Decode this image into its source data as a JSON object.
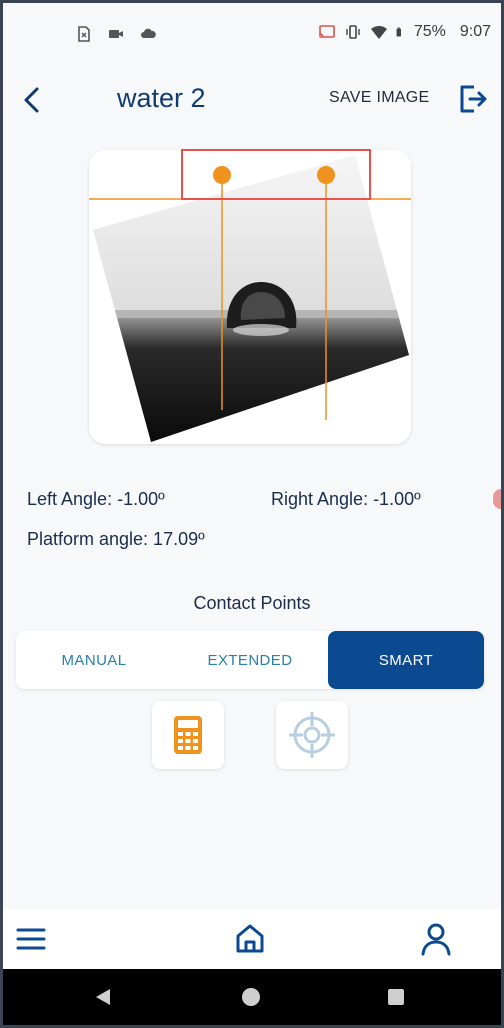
{
  "status_bar": {
    "battery": "75%",
    "time": "9:07",
    "left_icons": [
      "no-sim-icon",
      "video-icon",
      "cloud-icon"
    ],
    "right_icons": [
      "cast-icon",
      "vibrate-icon",
      "wifi-icon",
      "battery-icon"
    ]
  },
  "header": {
    "title": "water 2",
    "save_label": "SAVE IMAGE",
    "back_icon": "chevron-left-icon",
    "exit_icon": "logout-icon"
  },
  "measurements": {
    "left_angle": "Left Angle: -1.00º",
    "right_angle": "Right Angle: -1.00º",
    "platform_angle": "Platform angle: 17.09º"
  },
  "contact_points": {
    "title": "Contact Points",
    "modes": [
      "MANUAL",
      "EXTENDED",
      "SMART"
    ],
    "selected": "SMART"
  },
  "tools": [
    "calculator-icon",
    "crosshair-icon"
  ],
  "bottom_nav": [
    "menu-icon",
    "home-icon",
    "profile-icon"
  ],
  "system_nav": [
    "back-triangle-icon",
    "home-circle-icon",
    "recents-square-icon"
  ],
  "colors": {
    "primary": "#0b4a91",
    "title": "#0d3c73",
    "accent_orange": "#f0921e",
    "highlight_red": "#e8524a"
  }
}
